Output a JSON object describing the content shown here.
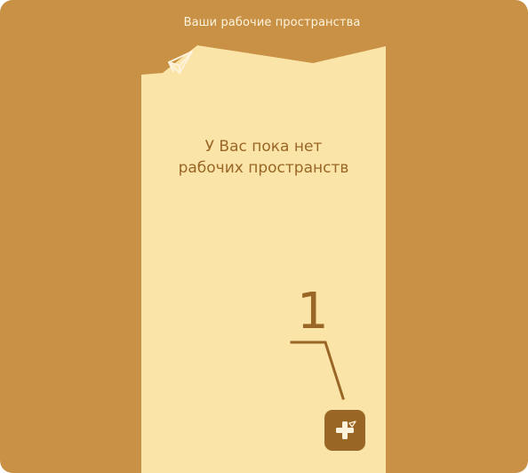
{
  "header": {
    "title": "Ваши рабочие пространства"
  },
  "empty_state": {
    "line1": "У Вас пока нет",
    "line2": "рабочих пространств"
  },
  "tutorial": {
    "step_number": "1"
  },
  "actions": {
    "add_workspace_icon": "plus-icon"
  },
  "colors": {
    "background": "#c99145",
    "sheet": "#fbe4a8",
    "accent": "#9a6626",
    "header_text": "#fdf3dc"
  }
}
